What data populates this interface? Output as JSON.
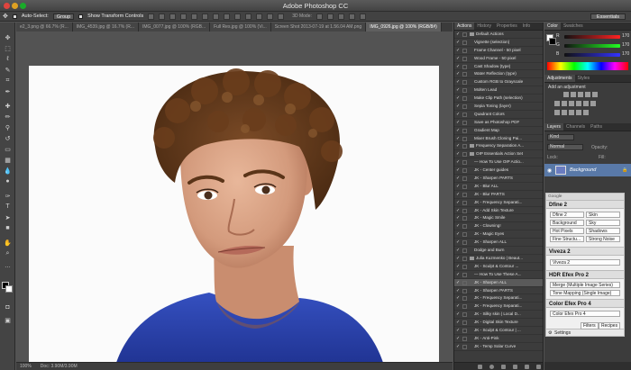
{
  "app": {
    "title": "Adobe Photoshop CC"
  },
  "options_bar": {
    "auto_select_label": "Auto-Select:",
    "group_value": "Group",
    "transform_label": "Show Transform Controls",
    "mode_label": "3D Mode:",
    "workspace": "Essentials"
  },
  "document_tabs": [
    {
      "label": "e2_3.png @ 66.7% (R...",
      "active": false
    },
    {
      "label": "IMG_4539.jpg @ 16.7% (R...",
      "active": false
    },
    {
      "label": "IMG_0077.jpg @ 100% (RGB...",
      "active": false
    },
    {
      "label": "Full Res.jpg @ 100% (Vi...",
      "active": false
    },
    {
      "label": "Screen Shot 2013-07-19 at 1.56.04 AM.png",
      "active": false
    },
    {
      "label": "IMG_0926.jpg @ 100% (RGB/8#)",
      "active": true
    }
  ],
  "status": {
    "zoom": "100%",
    "doc": "Doc: 3.90M/3.90M"
  },
  "actions_panel": {
    "tabs": [
      "Actions",
      "History",
      "Properties",
      "Info"
    ],
    "items": [
      {
        "label": "Default Actions",
        "type": "set",
        "checked": true,
        "selected": false
      },
      {
        "label": "Vignette (selection)",
        "type": "action",
        "checked": true,
        "selected": false
      },
      {
        "label": "Frame Channel - 50 pixel",
        "type": "action",
        "checked": true,
        "selected": false
      },
      {
        "label": "Wood Frame - 50 pixel",
        "type": "action",
        "checked": true,
        "selected": false
      },
      {
        "label": "Cast Shadow (type)",
        "type": "action",
        "checked": true,
        "selected": false
      },
      {
        "label": "Water Reflection (type)",
        "type": "action",
        "checked": true,
        "selected": false
      },
      {
        "label": "Custom RGB to Grayscale",
        "type": "action",
        "checked": true,
        "selected": false
      },
      {
        "label": "Molten Lead",
        "type": "action",
        "checked": true,
        "selected": false
      },
      {
        "label": "Make Clip Path (selection)",
        "type": "action",
        "checked": true,
        "selected": false
      },
      {
        "label": "Sepia Toning (layer)",
        "type": "action",
        "checked": true,
        "selected": false
      },
      {
        "label": "Quadrant Colors",
        "type": "action",
        "checked": true,
        "selected": false
      },
      {
        "label": "Save as Photoshop PDF",
        "type": "action",
        "checked": true,
        "selected": false
      },
      {
        "label": "Gradient Map",
        "type": "action",
        "checked": true,
        "selected": false
      },
      {
        "label": "Mixer Brush Cloning Pai...",
        "type": "action",
        "checked": true,
        "selected": false
      },
      {
        "label": "Frequency Separation A...",
        "type": "set",
        "checked": true,
        "selected": false
      },
      {
        "label": "OIP Essentials Action Set",
        "type": "set",
        "checked": true,
        "selected": false
      },
      {
        "label": "— How To Use OIP Actio...",
        "type": "action",
        "checked": true,
        "selected": false
      },
      {
        "label": "JK - Center guides",
        "type": "action",
        "checked": true,
        "selected": false
      },
      {
        "label": "JK - Sharpen PARTS",
        "type": "action",
        "checked": true,
        "selected": false
      },
      {
        "label": "JK - Blur ALL",
        "type": "action",
        "checked": true,
        "selected": false
      },
      {
        "label": "JK - Blur PARTS",
        "type": "action",
        "checked": true,
        "selected": false
      },
      {
        "label": "JK - Frequency Separati...",
        "type": "action",
        "checked": true,
        "selected": false
      },
      {
        "label": "JK - Add Skin Texture",
        "type": "action",
        "checked": true,
        "selected": false
      },
      {
        "label": "JK - Magic Smile",
        "type": "action",
        "checked": true,
        "selected": false
      },
      {
        "label": "JK - Clowning!",
        "type": "action",
        "checked": true,
        "selected": false
      },
      {
        "label": "JK - Magic Eyes",
        "type": "action",
        "checked": true,
        "selected": false
      },
      {
        "label": "JK - Sharpen ALL",
        "type": "action",
        "checked": true,
        "selected": false
      },
      {
        "label": "Dodge and Burn",
        "type": "action",
        "checked": true,
        "selected": false
      },
      {
        "label": "Julia Kuzmenko | Beaut...",
        "type": "set",
        "checked": true,
        "selected": false
      },
      {
        "label": "JK - Sculpt & Contour ...",
        "type": "action",
        "checked": true,
        "selected": false
      },
      {
        "label": "— How To Use These A...",
        "type": "action",
        "checked": true,
        "selected": false
      },
      {
        "label": "JK - Sharpen ALL",
        "type": "action",
        "checked": true,
        "selected": true
      },
      {
        "label": "JK - Sharpen PARTS",
        "type": "action",
        "checked": true,
        "selected": false
      },
      {
        "label": "JK - Frequency Separati...",
        "type": "action",
        "checked": true,
        "selected": false
      },
      {
        "label": "JK - Frequency Separati...",
        "type": "action",
        "checked": true,
        "selected": false
      },
      {
        "label": "JK - Silky skin | Local D...",
        "type": "action",
        "checked": true,
        "selected": false
      },
      {
        "label": "JK - Digital Skin Texture",
        "type": "action",
        "checked": true,
        "selected": false
      },
      {
        "label": "JK - Sculpt & Contour | ...",
        "type": "action",
        "checked": true,
        "selected": false
      },
      {
        "label": "JK - Anti-Pink",
        "type": "action",
        "checked": true,
        "selected": false
      },
      {
        "label": "JK - Temp Solar Curve",
        "type": "action",
        "checked": true,
        "selected": false
      }
    ]
  },
  "color_panel": {
    "tabs": [
      "Color",
      "Swatches"
    ],
    "r_label": "R",
    "g_label": "G",
    "b_label": "B",
    "r": "170",
    "g": "170",
    "b": "170"
  },
  "adjustments_panel": {
    "tabs": [
      "Adjustments",
      "Styles"
    ],
    "add_label": "Add an adjustment"
  },
  "layers_panel": {
    "tabs": [
      "Layers",
      "Channels",
      "Paths"
    ],
    "kind": "Kind",
    "blend_mode": "Normal",
    "opacity_label": "Opacity:",
    "lock_label": "Lock:",
    "fill_label": "Fill:",
    "layer_name": "Background"
  },
  "nik": {
    "header": "Google",
    "dfine": {
      "title": "Dfine 2",
      "buttons": [
        "Dfine 2",
        "Skin",
        "Background",
        "Sky",
        "Hot Pixels",
        "Shadows",
        "Fine Structu...",
        "Strong Noise"
      ]
    },
    "viveza": {
      "title": "Viveza 2",
      "buttons": [
        "Viveza 2"
      ]
    },
    "hdr": {
      "title": "HDR Efex Pro 2",
      "buttons": [
        "Merge (Multiple Image Series)",
        "Tone Mapping (Single Image)"
      ]
    },
    "color_efex": {
      "title": "Color Efex Pro 4",
      "buttons": [
        "Color Efex Pro 4"
      ]
    },
    "footer_tabs": [
      "Filters",
      "Recipes"
    ],
    "settings": "Settings"
  },
  "colors": {
    "accent": "#2f6ec0",
    "panel": "#3c3c3c",
    "shirt": "#2a42a8"
  }
}
